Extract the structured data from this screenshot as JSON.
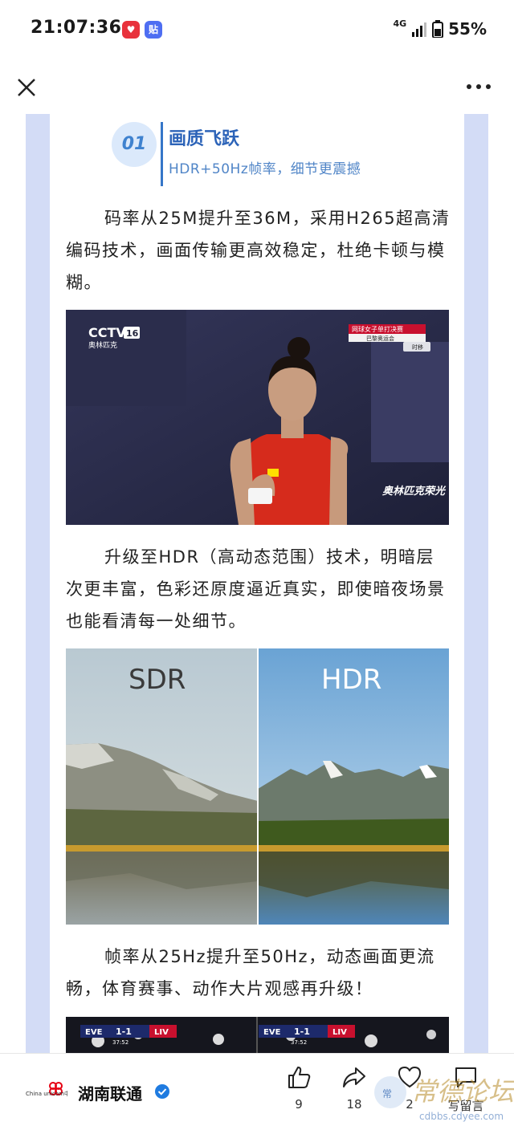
{
  "status_bar": {
    "time": "21:07:36",
    "network": "4G",
    "battery": "55%"
  },
  "section": {
    "number": "01",
    "title": "画质飞跃",
    "subtitle": "HDR+50Hz帧率，细节更震撼"
  },
  "paragraphs": [
    "码率从25M提升至36M，采用H265超高清编码技术，画面传输更高效稳定，杜绝卡顿与模糊。",
    "升级至HDR（高动态范围）技术，明暗层次更丰富，色彩还原度逼近真实，即使暗夜场景也能看清每一处细节。",
    "帧率从25Hz提升至50Hz，动态画面更流畅，体育赛事、动作大片观感再升级！"
  ],
  "image1": {
    "channel": "CCTV",
    "channel_number": "16",
    "channel_sub": "奥林匹克",
    "caption_line1": "网球女子单打决赛",
    "caption_line2": "巴黎奥运会",
    "caption_tag": "时移",
    "corner_text": "奥林匹克荣光"
  },
  "image2": {
    "left_label": "SDR",
    "right_label": "HDR"
  },
  "image3": {
    "team_home": "EVE",
    "team_away": "LIV",
    "score": "1-1",
    "clock": "37:52"
  },
  "bottom_bar": {
    "account_name": "湖南联通",
    "logo_text_cn": "China unicom中国联通",
    "like_count": "9",
    "share_count": "18",
    "favorite_count": "2",
    "comment_label": "写留言"
  },
  "watermark": {
    "text": "常德论坛",
    "url": "cdbbs.cdyee.com"
  },
  "colors": {
    "accent": "#2c63b8",
    "frame": "#d3dcf6",
    "verified": "#1f7be0",
    "unicom_red": "#e60012"
  }
}
